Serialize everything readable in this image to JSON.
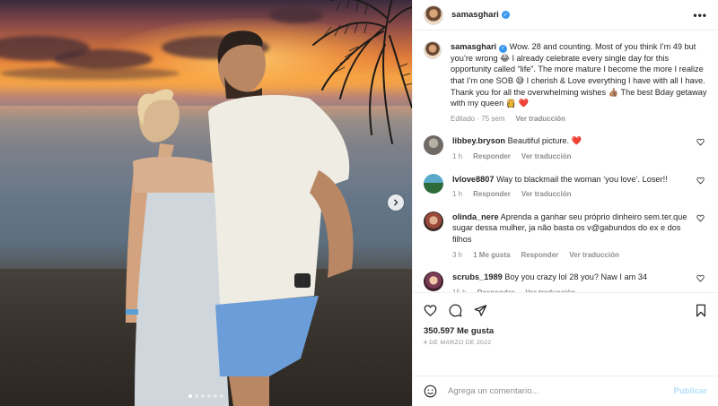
{
  "post": {
    "author": "samasghari",
    "verified": true,
    "caption_text": "Wow. 28 and counting. Most of you think I’m 49 but you’re wrong 😂 I already celebrate every single day for this opportunity called “life”. The more mature I become the more I realize that I’m one SOB 😅 I cherish & Love everything I have with all I have. Thank you for all the overwhelming wishes 👍🏽 The best Bday getaway with my queen 👸 ❤️",
    "edited_label": "Editado · 75 sem",
    "translate_label": "Ver traducción",
    "likes": "350.597 Me gusta",
    "date": "4 DE MARZO DE 2022"
  },
  "carousel": {
    "dot_count": 6,
    "active_index": 0
  },
  "comments": [
    {
      "user": "libbey.bryson",
      "text": "Beautiful picture. ❤️",
      "time": "1 h",
      "reply": "Responder",
      "translate": "Ver traducción",
      "likes": ""
    },
    {
      "user": "lvlove8807",
      "text": "Way to blackmail the woman ‘you love’. Loser!!",
      "time": "1 h",
      "reply": "Responder",
      "translate": "Ver traducción",
      "likes": ""
    },
    {
      "user": "olinda_nere",
      "text": "Aprenda a ganhar seu próprio dinheiro sem.ter.que sugar dessa mulher, ja não basta os v@gabundos do ex e dos filhos",
      "time": "3 h",
      "reply": "Responder",
      "translate": "Ver traducción",
      "likes": "1 Me gusta"
    },
    {
      "user": "scrubs_1989",
      "text": "Boy you crazy lol 28 you? Naw I am 34",
      "time": "15 h",
      "reply": "Responder",
      "translate": "Ver traducción",
      "likes": ""
    }
  ],
  "compose": {
    "placeholder": "Agrega un comentario...",
    "publish_label": "Publicar"
  },
  "icons": [
    "more-options-icon",
    "verified-badge-icon",
    "heart-icon",
    "comment-icon",
    "share-icon",
    "save-icon",
    "emoji-icon",
    "chevron-right-icon"
  ],
  "colors": {
    "verified": "#3897f0",
    "publish": "#b2dffc",
    "muted": "#8e8e8e",
    "like_heart": "#ed4956"
  }
}
